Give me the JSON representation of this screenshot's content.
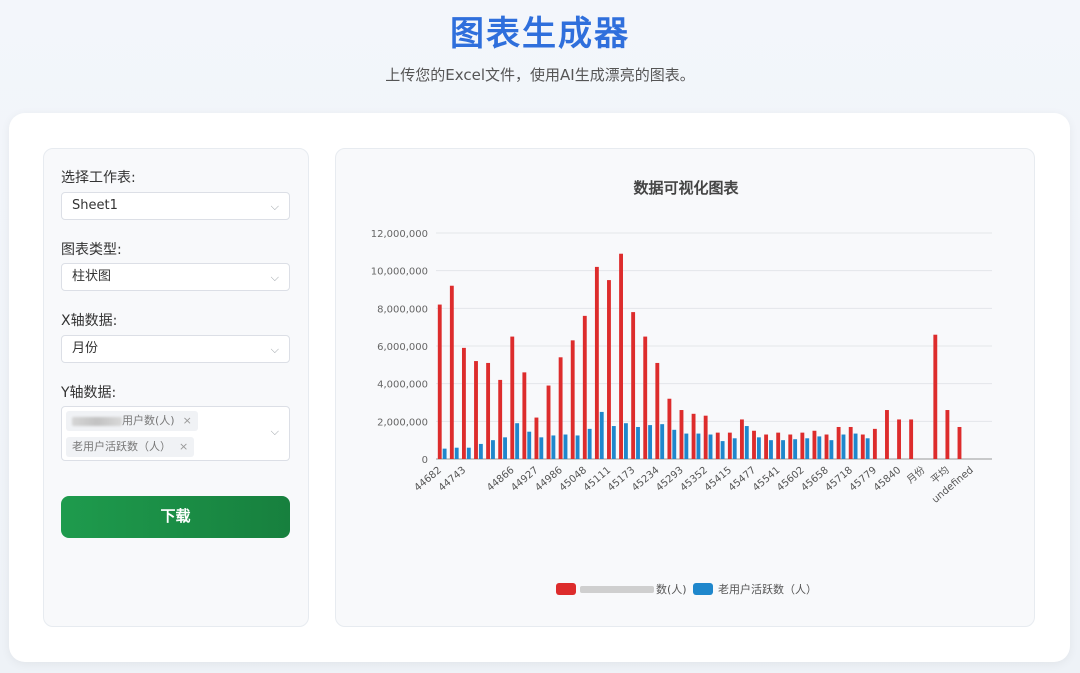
{
  "header": {
    "title": "图表生成器",
    "subtitle": "上传您的Excel文件，使用AI生成漂亮的图表。"
  },
  "controls": {
    "sheet_label": "选择工作表:",
    "sheet_value": "Sheet1",
    "type_label": "图表类型:",
    "type_value": "柱状图",
    "x_label": "X轴数据:",
    "x_value": "月份",
    "y_label": "Y轴数据:",
    "y_tags": [
      "用户数(人)",
      "老用户活跃数（人）"
    ],
    "download_label": "下载"
  },
  "colors": {
    "series1": "#dd2c2c",
    "series2": "#1f87cc",
    "accent": "#2f6fdc",
    "button": "#1e9b4d"
  },
  "chart_data": {
    "type": "bar",
    "title": "数据可视化图表",
    "x": [
      "44682",
      "44713",
      "44743",
      "44774",
      "44805",
      "44835",
      "44866",
      "44896",
      "44927",
      "44958",
      "44986",
      "45017",
      "45048",
      "45078",
      "45111",
      "45142",
      "45173",
      "45203",
      "45234",
      "45264",
      "45293",
      "45323",
      "45352",
      "45383",
      "45415",
      "45446",
      "45477",
      "45508",
      "45541",
      "45571",
      "45602",
      "45632",
      "45658",
      "45689",
      "45718",
      "45748",
      "45779",
      "45809",
      "45840",
      "45870",
      "月份",
      "",
      "平均",
      "",
      "undefined",
      ""
    ],
    "xtick_labels": [
      "44682",
      "44743",
      "44807",
      "44866",
      "44927",
      "44986",
      "45048",
      "45111",
      "45173",
      "45234",
      "45293",
      "45352",
      "45415",
      "45477",
      "45541",
      "45602",
      "45658",
      "45718",
      "45779",
      "45840",
      "月份",
      "平均",
      "undefined"
    ],
    "ylim": [
      0,
      12000000
    ],
    "yticks": [
      "0",
      "2,000,000",
      "4,000,000",
      "6,000,000",
      "8,000,000",
      "10,000,000",
      "12,000,000"
    ],
    "series": [
      {
        "name": "数(人)",
        "values": [
          8200000,
          9200000,
          5900000,
          5200000,
          5100000,
          4200000,
          6500000,
          4600000,
          2200000,
          3900000,
          5400000,
          6300000,
          7600000,
          10200000,
          9500000,
          10900000,
          7800000,
          6500000,
          5100000,
          3200000,
          2600000,
          2400000,
          2300000,
          1400000,
          1400000,
          2100000,
          1500000,
          1300000,
          1400000,
          1300000,
          1400000,
          1500000,
          1300000,
          1700000,
          1700000,
          1300000,
          1600000,
          2600000,
          2100000,
          2100000,
          0,
          6600000,
          2600000,
          1700000,
          0,
          0
        ]
      },
      {
        "name": "老用户活跃数（人）",
        "values": [
          550000,
          600000,
          600000,
          800000,
          1000000,
          1150000,
          1900000,
          1450000,
          1150000,
          1250000,
          1300000,
          1250000,
          1600000,
          2500000,
          1750000,
          1900000,
          1700000,
          1800000,
          1850000,
          1550000,
          1350000,
          1350000,
          1300000,
          950000,
          1100000,
          1750000,
          1150000,
          1000000,
          1000000,
          1050000,
          1100000,
          1200000,
          1000000,
          1300000,
          1350000,
          1100000,
          0,
          0,
          0,
          0,
          0,
          0,
          0,
          0,
          0,
          0
        ]
      }
    ],
    "legend_position": "bottom",
    "grid": true
  }
}
